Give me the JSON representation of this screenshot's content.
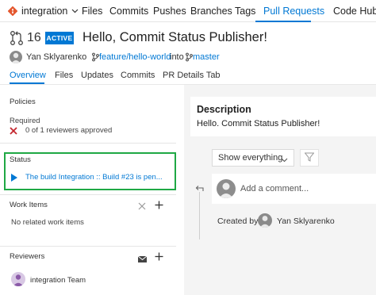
{
  "topnav": {
    "repo": "integration",
    "items": [
      "Files",
      "Commits",
      "Pushes",
      "Branches",
      "Tags",
      "Pull Requests",
      "Code Hub"
    ],
    "active_index": 5
  },
  "pr": {
    "number": "16",
    "status_badge": "ACTIVE",
    "title": "Hello, Commit Status Publisher!",
    "author": "Yan Sklyarenko",
    "source_branch": "feature/hello-world",
    "into": "into",
    "target_branch": "master"
  },
  "subtabs": [
    "Overview",
    "Files",
    "Updates",
    "Commits",
    "PR Details Tab"
  ],
  "left": {
    "policies": {
      "title": "Policies",
      "required_label": "Required",
      "reviewers_text": "0 of 1 reviewers approved"
    },
    "status": {
      "title": "Status",
      "build_text": "The build Integration :: Build #23 is pen..."
    },
    "work_items": {
      "title": "Work Items",
      "empty_text": "No related work items"
    },
    "reviewers": {
      "title": "Reviewers",
      "items": [
        {
          "name": "integration Team"
        }
      ]
    }
  },
  "right": {
    "description": {
      "title": "Description",
      "body": "Hello. Commit Status Publisher!"
    },
    "filter": {
      "selected": "Show everything"
    },
    "comment": {
      "placeholder": "Add a comment..."
    },
    "created_by": {
      "label": "Created by",
      "name": "Yan Sklyarenko"
    }
  },
  "colors": {
    "accent": "#0078d4",
    "status_highlight": "#1fa844",
    "reject": "#c4262e",
    "repo_icon": "#e4572e"
  },
  "icons": [
    "repo-icon",
    "chevron-down-icon",
    "pull-request-icon",
    "branch-icon",
    "close-icon",
    "play-icon",
    "add-icon",
    "mail-icon",
    "funnel-icon",
    "reply-icon"
  ]
}
